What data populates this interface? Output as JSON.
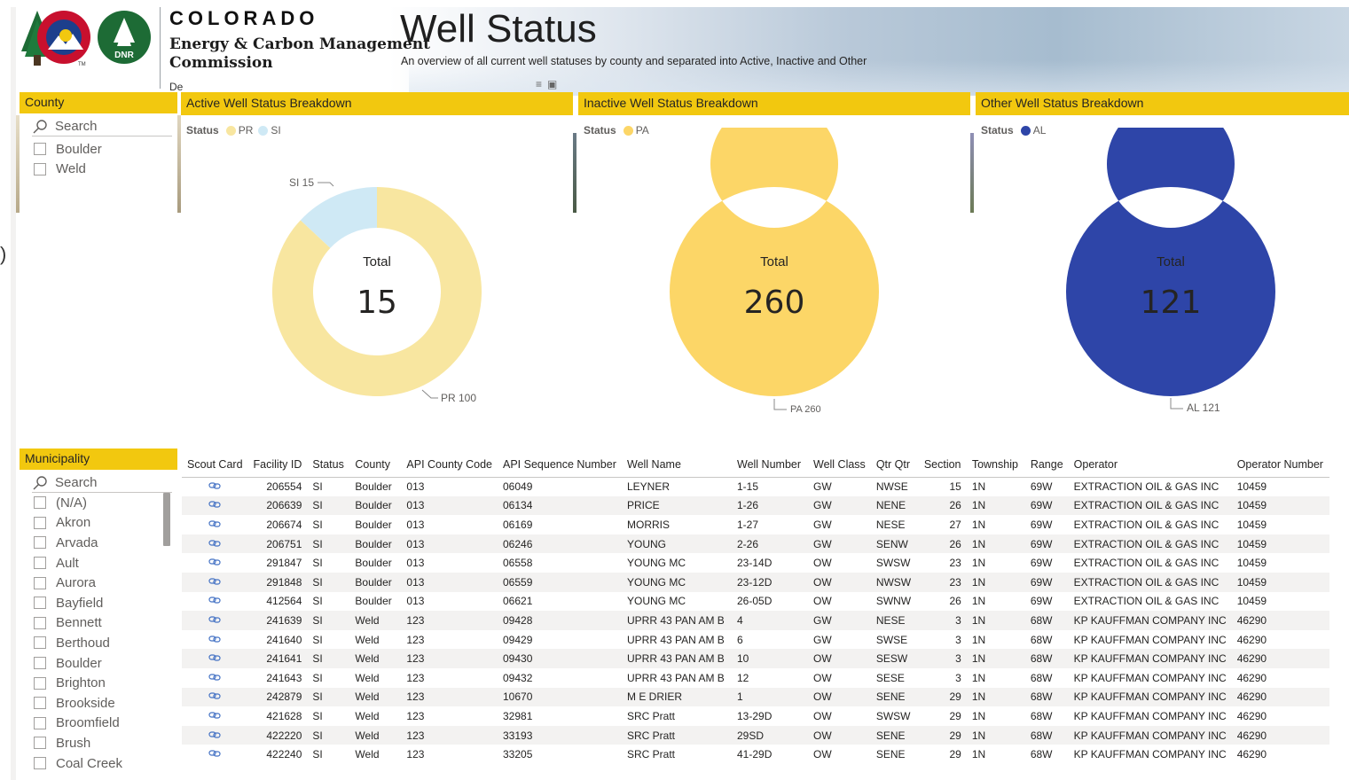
{
  "header": {
    "brand_state": "COLORADO",
    "brand_line1": "Energy & Carbon Management",
    "brand_line2": "Commission",
    "brand_partial": "De",
    "dnr_label": "DNR",
    "tm": "TM",
    "title": "Well Status",
    "subtitle": "An overview of all current well statuses by county and separated into Active, Inactive and Other"
  },
  "county_slicer": {
    "title": "County",
    "search_placeholder": "Search",
    "items": [
      "Boulder",
      "Weld"
    ]
  },
  "municipality_slicer": {
    "title": "Municipality",
    "search_placeholder": "Search",
    "items": [
      "(N/A)",
      "Akron",
      "Arvada",
      "Ault",
      "Aurora",
      "Bayfield",
      "Bennett",
      "Berthoud",
      "Boulder",
      "Brighton",
      "Brookside",
      "Broomfield",
      "Brush",
      "Coal Creek"
    ]
  },
  "colors": {
    "accent_yellow": "#f2c80f",
    "pr": "#f8e6a0",
    "si": "#cfe9f5",
    "pa": "#fcd667",
    "al": "#2e45a8"
  },
  "charts": {
    "active": {
      "title": "Active Well Status Breakdown",
      "legend_title": "Status",
      "legend": [
        {
          "name": "PR",
          "color": "#f8e6a0"
        },
        {
          "name": "SI",
          "color": "#cfe9f5"
        }
      ],
      "center_label": "Total",
      "center_value": "15",
      "labels": [
        "SI 15",
        "PR 100"
      ]
    },
    "inactive": {
      "title": "Inactive Well Status Breakdown",
      "legend_title": "Status",
      "legend": [
        {
          "name": "PA",
          "color": "#fcd667"
        }
      ],
      "center_label": "Total",
      "center_value": "260",
      "labels": [
        "PA 260"
      ]
    },
    "other": {
      "title": "Other Well Status Breakdown",
      "legend_title": "Status",
      "legend": [
        {
          "name": "AL",
          "color": "#2e45a8"
        }
      ],
      "center_label": "Total",
      "center_value": "121",
      "labels": [
        "AL 121"
      ]
    }
  },
  "chart_data": [
    {
      "type": "pie",
      "title": "Active Well Status Breakdown",
      "categories": [
        "PR",
        "SI"
      ],
      "values": [
        100,
        15
      ],
      "legend": "top-left"
    },
    {
      "type": "pie",
      "title": "Inactive Well Status Breakdown",
      "categories": [
        "PA"
      ],
      "values": [
        260
      ],
      "legend": "top-left"
    },
    {
      "type": "pie",
      "title": "Other Well Status Breakdown",
      "categories": [
        "AL"
      ],
      "values": [
        121
      ],
      "legend": "top-left"
    }
  ],
  "table": {
    "columns": [
      "Scout Card",
      "Facility ID",
      "Status",
      "County",
      "API County Code",
      "API Sequence Number",
      "Well Name",
      "Well Number",
      "Well Class",
      "Qtr Qtr",
      "Section",
      "Township",
      "Range",
      "Operator",
      "Operator Number"
    ],
    "rows": [
      [
        "206554",
        "SI",
        "Boulder",
        "013",
        "06049",
        "LEYNER",
        "1-15",
        "GW",
        "NWSE",
        "15",
        "1N",
        "69W",
        "EXTRACTION OIL & GAS INC",
        "10459"
      ],
      [
        "206639",
        "SI",
        "Boulder",
        "013",
        "06134",
        "PRICE",
        "1-26",
        "GW",
        "NENE",
        "26",
        "1N",
        "69W",
        "EXTRACTION OIL & GAS INC",
        "10459"
      ],
      [
        "206674",
        "SI",
        "Boulder",
        "013",
        "06169",
        "MORRIS",
        "1-27",
        "GW",
        "NESE",
        "27",
        "1N",
        "69W",
        "EXTRACTION OIL & GAS INC",
        "10459"
      ],
      [
        "206751",
        "SI",
        "Boulder",
        "013",
        "06246",
        "YOUNG",
        "2-26",
        "GW",
        "SENW",
        "26",
        "1N",
        "69W",
        "EXTRACTION OIL & GAS INC",
        "10459"
      ],
      [
        "291847",
        "SI",
        "Boulder",
        "013",
        "06558",
        "YOUNG MC",
        "23-14D",
        "OW",
        "SWSW",
        "23",
        "1N",
        "69W",
        "EXTRACTION OIL & GAS INC",
        "10459"
      ],
      [
        "291848",
        "SI",
        "Boulder",
        "013",
        "06559",
        "YOUNG MC",
        "23-12D",
        "OW",
        "NWSW",
        "23",
        "1N",
        "69W",
        "EXTRACTION OIL & GAS INC",
        "10459"
      ],
      [
        "412564",
        "SI",
        "Boulder",
        "013",
        "06621",
        "YOUNG MC",
        "26-05D",
        "OW",
        "SWNW",
        "26",
        "1N",
        "69W",
        "EXTRACTION OIL & GAS INC",
        "10459"
      ],
      [
        "241639",
        "SI",
        "Weld",
        "123",
        "09428",
        "UPRR 43 PAN AM B",
        "4",
        "GW",
        "NESE",
        "3",
        "1N",
        "68W",
        "KP KAUFFMAN COMPANY INC",
        "46290"
      ],
      [
        "241640",
        "SI",
        "Weld",
        "123",
        "09429",
        "UPRR 43 PAN AM B",
        "6",
        "GW",
        "SWSE",
        "3",
        "1N",
        "68W",
        "KP KAUFFMAN COMPANY INC",
        "46290"
      ],
      [
        "241641",
        "SI",
        "Weld",
        "123",
        "09430",
        "UPRR 43 PAN AM B",
        "10",
        "OW",
        "SESW",
        "3",
        "1N",
        "68W",
        "KP KAUFFMAN COMPANY INC",
        "46290"
      ],
      [
        "241643",
        "SI",
        "Weld",
        "123",
        "09432",
        "UPRR 43 PAN AM B",
        "12",
        "OW",
        "SESE",
        "3",
        "1N",
        "68W",
        "KP KAUFFMAN COMPANY INC",
        "46290"
      ],
      [
        "242879",
        "SI",
        "Weld",
        "123",
        "10670",
        "M E DRIER",
        "1",
        "OW",
        "SENE",
        "29",
        "1N",
        "68W",
        "KP KAUFFMAN COMPANY INC",
        "46290"
      ],
      [
        "421628",
        "SI",
        "Weld",
        "123",
        "32981",
        "SRC Pratt",
        "13-29D",
        "OW",
        "SWSW",
        "29",
        "1N",
        "68W",
        "KP KAUFFMAN COMPANY INC",
        "46290"
      ],
      [
        "422220",
        "SI",
        "Weld",
        "123",
        "33193",
        "SRC Pratt",
        "29SD",
        "OW",
        "SENE",
        "29",
        "1N",
        "68W",
        "KP KAUFFMAN COMPANY INC",
        "46290"
      ],
      [
        "422240",
        "SI",
        "Weld",
        "123",
        "33205",
        "SRC Pratt",
        "41-29D",
        "OW",
        "SENE",
        "29",
        "1N",
        "68W",
        "KP KAUFFMAN COMPANY INC",
        "46290"
      ]
    ]
  }
}
